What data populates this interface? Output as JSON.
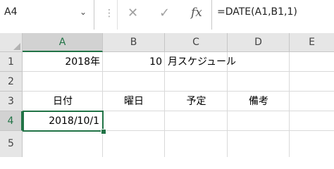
{
  "formula_bar": {
    "name_box": "A4",
    "formula": "=DATE(A1,B1,1)",
    "icons": {
      "name_box_dropdown": "chevron-down-icon",
      "cancel": "x-icon",
      "enter": "check-icon",
      "insert_function": "fx-icon"
    }
  },
  "columns": [
    "A",
    "B",
    "C",
    "D",
    "E"
  ],
  "rows": [
    "1",
    "2",
    "3",
    "4",
    "5"
  ],
  "cells": {
    "A1": "2018年",
    "B1": "10",
    "C1": "月スケジュール",
    "A3": "日付",
    "B3": "曜日",
    "C3": "予定",
    "D3": "備考",
    "A4": "2018/10/1"
  },
  "colors": {
    "accent": "#217346",
    "header_bg": "#e6e6e6",
    "selected_header_bg": "#d2d2d2"
  }
}
